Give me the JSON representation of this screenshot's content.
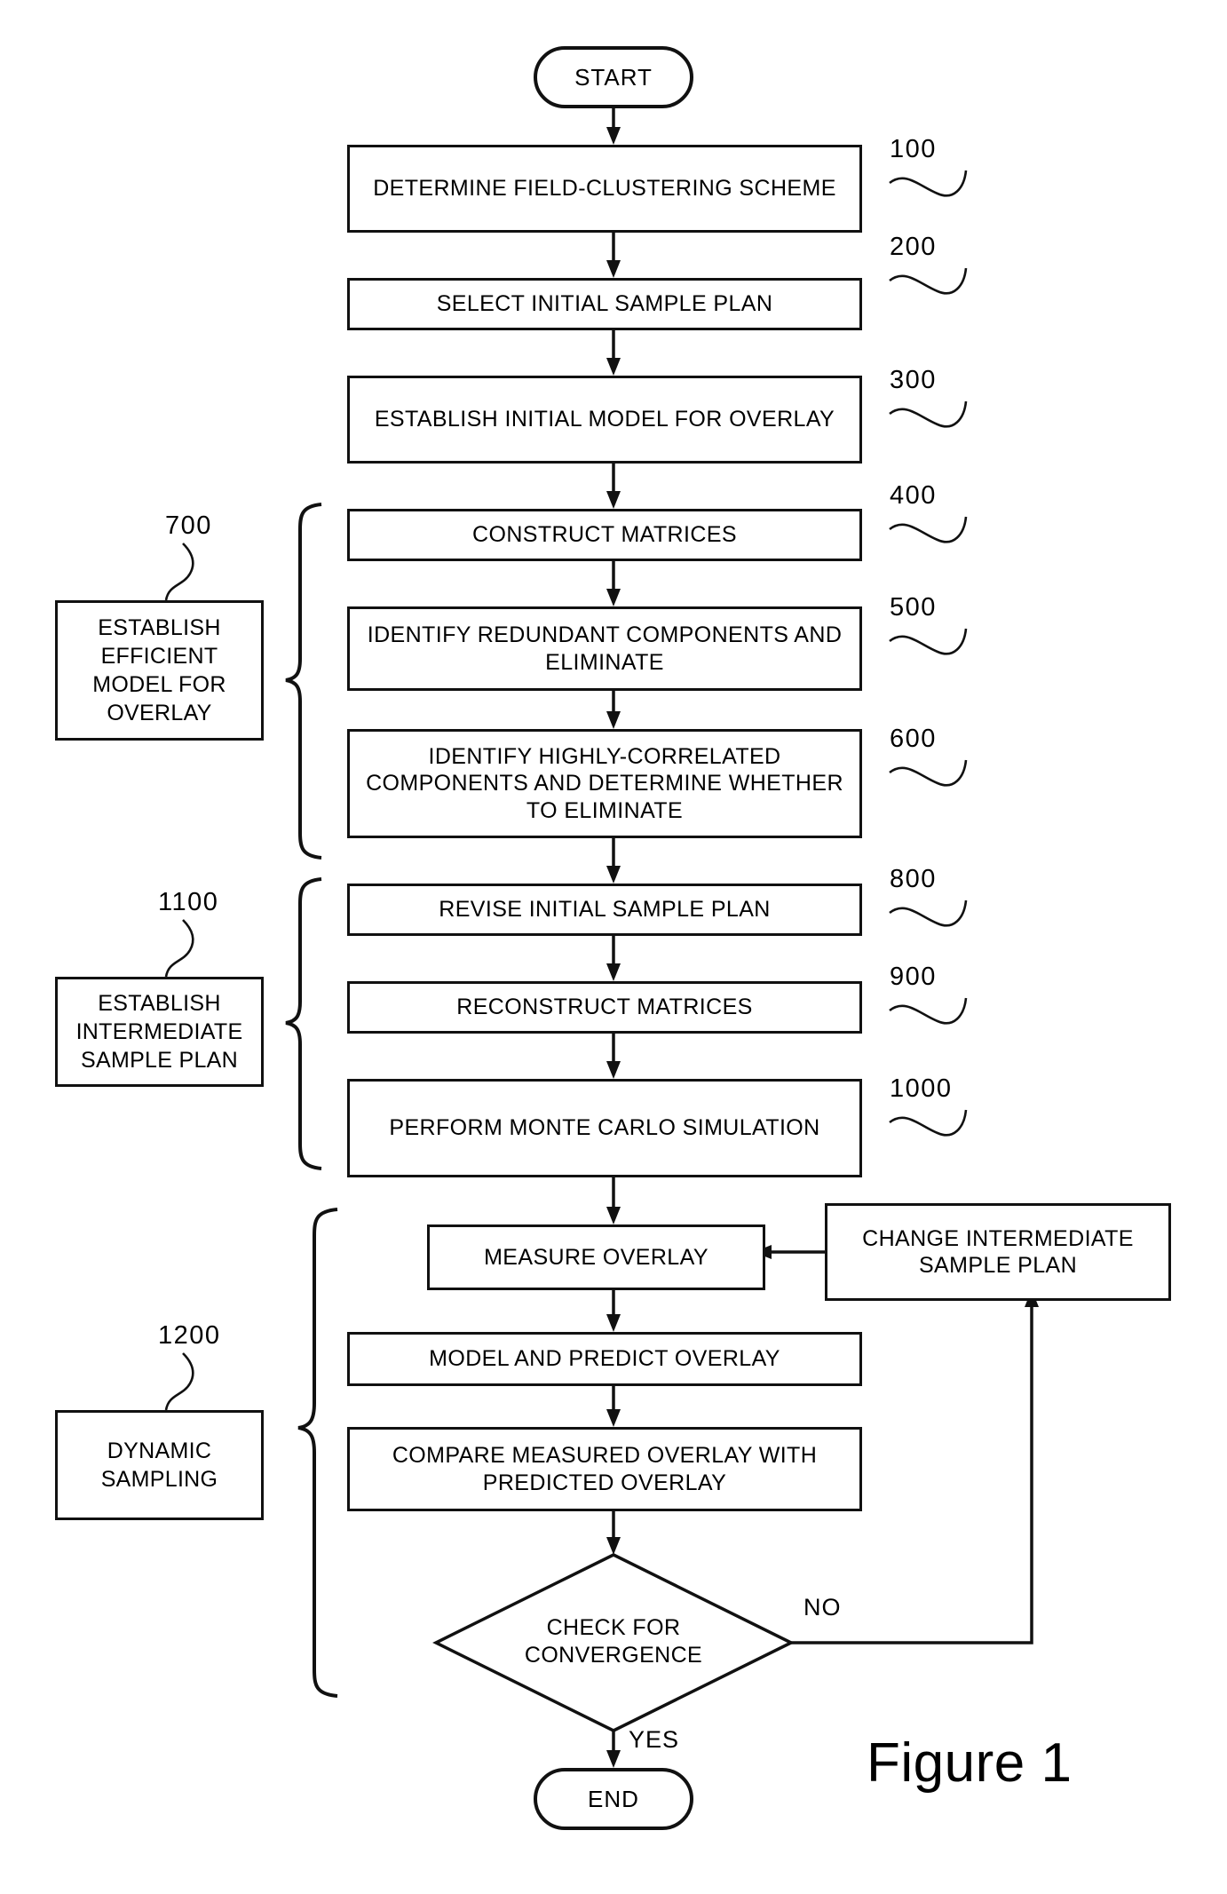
{
  "figure": {
    "caption": "Figure 1"
  },
  "terminators": {
    "start": "START",
    "end": "END"
  },
  "steps": [
    {
      "id": "100",
      "label": "DETERMINE FIELD-CLUSTERING SCHEME"
    },
    {
      "id": "200",
      "label": "SELECT INITIAL SAMPLE PLAN"
    },
    {
      "id": "300",
      "label": "ESTABLISH INITIAL MODEL FOR OVERLAY"
    },
    {
      "id": "400",
      "label": "CONSTRUCT MATRICES"
    },
    {
      "id": "500",
      "label": "IDENTIFY REDUNDANT COMPONENTS AND ELIMINATE"
    },
    {
      "id": "600",
      "label": "IDENTIFY HIGHLY-CORRELATED COMPONENTS AND DETERMINE WHETHER TO ELIMINATE"
    },
    {
      "id": "800",
      "label": "REVISE INITIAL SAMPLE PLAN"
    },
    {
      "id": "900",
      "label": "RECONSTRUCT MATRICES"
    },
    {
      "id": "1000",
      "label": "PERFORM MONTE CARLO SIMULATION"
    }
  ],
  "dynamic_steps": [
    {
      "label": "MEASURE OVERLAY"
    },
    {
      "label": "MODEL AND PREDICT OVERLAY"
    },
    {
      "label": "COMPARE MEASURED OVERLAY WITH PREDICTED OVERLAY"
    }
  ],
  "feedback_box": {
    "label": "CHANGE INTERMEDIATE SAMPLE PLAN"
  },
  "decision": {
    "label": "CHECK FOR CONVERGENCE",
    "branch_no": "NO",
    "branch_yes": "YES"
  },
  "group_labels": [
    {
      "id": "700",
      "label": "ESTABLISH EFFICIENT MODEL FOR OVERLAY"
    },
    {
      "id": "1100",
      "label": "ESTABLISH INTERMEDIATE SAMPLE PLAN"
    },
    {
      "id": "1200",
      "label": "DYNAMIC SAMPLING"
    }
  ],
  "reference_numerals": [
    "100",
    "200",
    "300",
    "400",
    "500",
    "600",
    "700",
    "800",
    "900",
    "1000",
    "1100",
    "1200"
  ],
  "colors": {
    "ink": "#111111",
    "paper": "#ffffff"
  }
}
